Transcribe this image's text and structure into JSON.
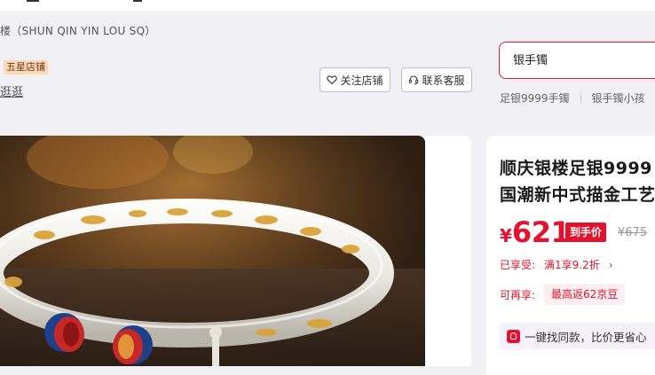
{
  "store": {
    "subtitle": "楼（SHUN QIN YIN LOU SQ）",
    "star_badge": "五星店铺",
    "browse_link": "逛逛",
    "follow_button": "关注店铺",
    "service_button": "联系客服"
  },
  "search": {
    "value": "银手镯",
    "hot_words": [
      "足银9999手镯",
      "银手镯小孩"
    ]
  },
  "product": {
    "title_line1": "顺庆银楼足银9999",
    "title_line2": "国潮新中式描金工艺",
    "currency": "¥",
    "price": "621",
    "handprice_tag": "到手价",
    "original_price": "¥675",
    "promo_label": "已享受:",
    "promo_value": "满1享9.2折",
    "promo_arrow": "›",
    "bean_label": "可再享:",
    "bean_value": "最高返62京豆",
    "same_style_text": "一键找同款，比价更省心"
  },
  "icons": {
    "follow": "heart-icon",
    "service": "headset-icon",
    "same_style": "bag-icon"
  },
  "colors": {
    "brand_red": "#e4122c",
    "badge_orange": "#ffd8b8"
  }
}
